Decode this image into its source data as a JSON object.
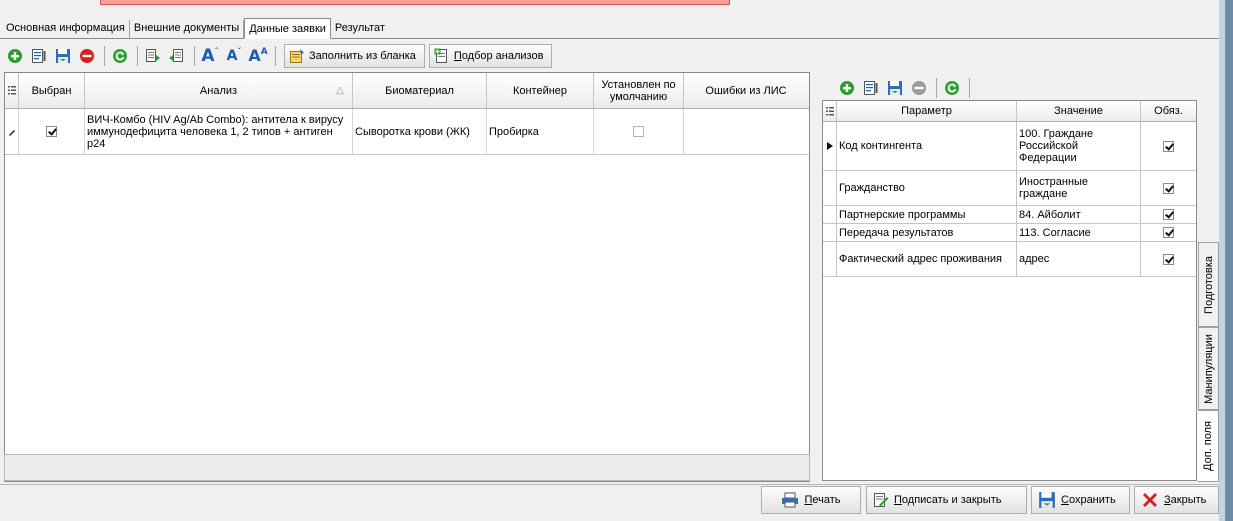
{
  "main_tabs": [
    {
      "label": "Основная информация"
    },
    {
      "label": "Внешние документы"
    },
    {
      "label": "Данные заявки"
    },
    {
      "label": "Результат"
    }
  ],
  "toolbar": {
    "font_a1": "A",
    "font_a2": "A",
    "font_a3": "A",
    "fill_from_form": "Заполнить из бланка",
    "analysis_pick_prefix": "П",
    "analysis_pick_rest": "одбор анализов"
  },
  "left_grid": {
    "columns": [
      "Выбран",
      "Анализ",
      "Биоматериал",
      "Контейнер",
      "Установлен по умолчанию",
      "Ошибки из ЛИС"
    ],
    "sort_glyph": "△",
    "rows": [
      {
        "selected": true,
        "analysis": "ВИЧ-Комбо (HIV Ag/Ab Combo): антитела к вирусу иммунодефицита человека 1, 2 типов + антиген p24",
        "biomaterial": "Сыворотка крови (ЖК)",
        "container": "Пробирка",
        "default": false,
        "errors": ""
      }
    ]
  },
  "right_grid": {
    "columns": [
      "Параметр",
      "Значение",
      "Обяз."
    ],
    "rows": [
      {
        "param": "Код контингента",
        "value": "100. Граждане Российской Федерации",
        "required": true,
        "current": true
      },
      {
        "param": "Гражданство",
        "value": "Иностранные граждане",
        "required": true,
        "current": false
      },
      {
        "param": "Партнерские программы",
        "value": "84. Айболит",
        "required": true,
        "current": false
      },
      {
        "param": "Передача результатов",
        "value": "113. Согласие",
        "required": true,
        "current": false
      },
      {
        "param": "Фактический адрес проживания",
        "value": "адрес",
        "required": true,
        "current": false
      }
    ]
  },
  "side_tabs": [
    "Подготовка",
    "Манипуляции",
    "Доп. поля"
  ],
  "footer": {
    "print": {
      "u": "П",
      "rest": "ечать"
    },
    "sign_close": {
      "u": "П",
      "rest": "одписать и закрыть"
    },
    "save": {
      "u": "С",
      "rest": "охранить"
    },
    "close": {
      "u": "З",
      "rest": "акрыть"
    }
  },
  "colors": {
    "add": "#2e9b2e",
    "delete": "#d81f1f",
    "refresh": "#2ea32e",
    "font_icon": "#1a5fa8",
    "close_x": "#d81f1f"
  }
}
